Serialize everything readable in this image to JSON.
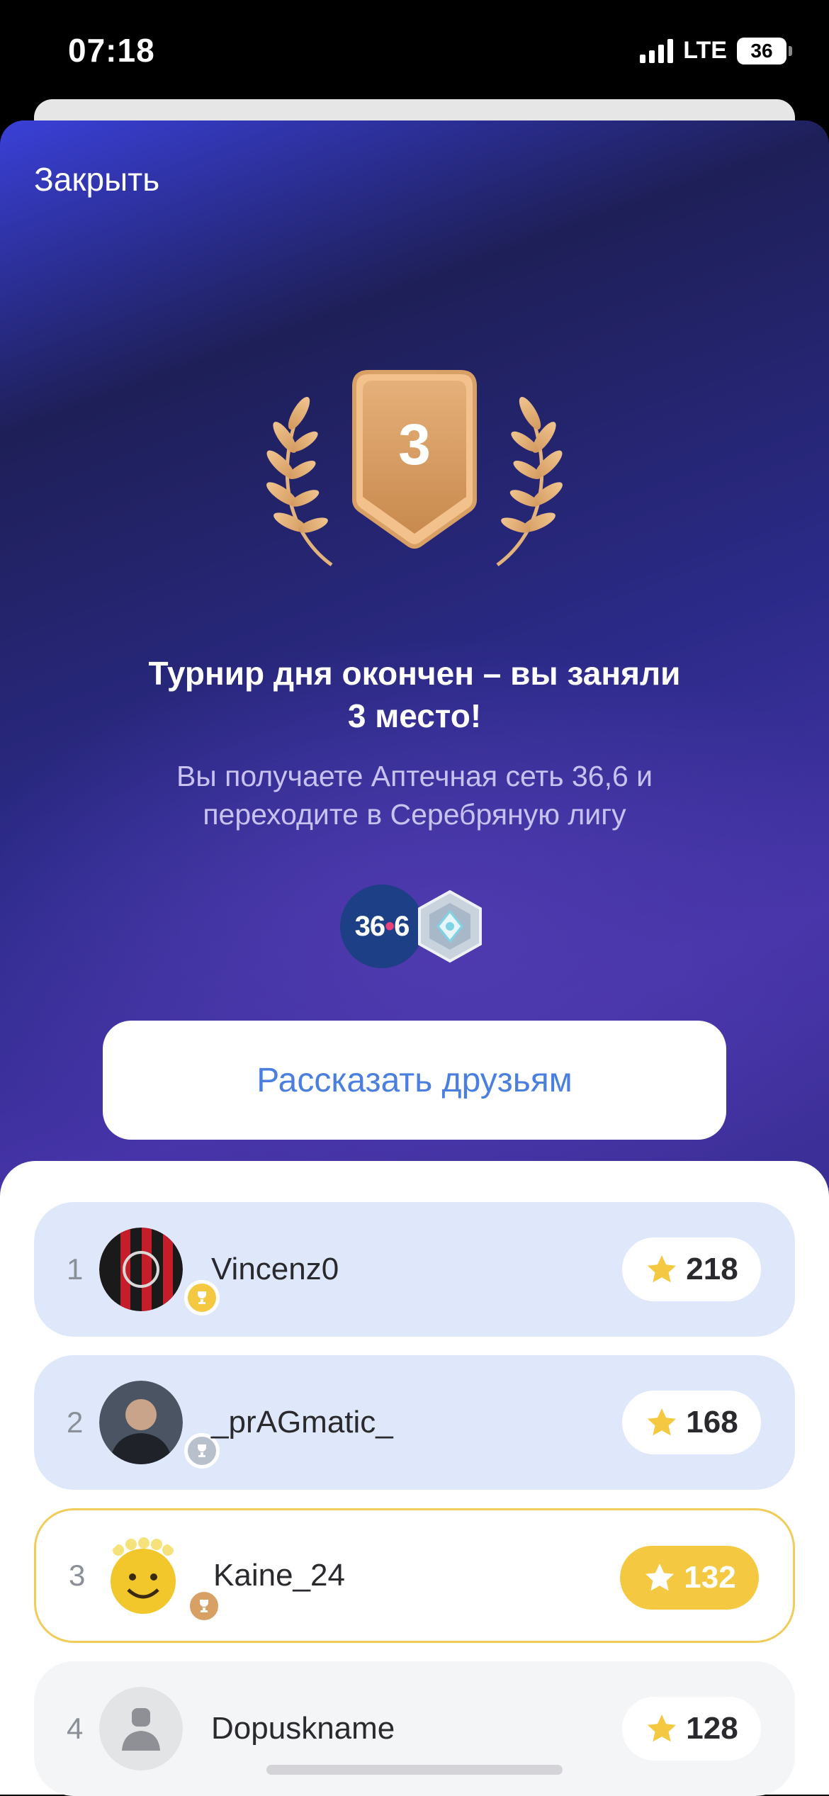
{
  "status_bar": {
    "time": "07:18",
    "network": "LTE",
    "battery": "36"
  },
  "sheet": {
    "close_label": "Закрыть",
    "place_number": "3",
    "headline_line1": "Турнир дня окончен – вы заняли",
    "headline_line2": "3 место!",
    "subline_line1": "Вы получаете Аптечная сеть 36,6 и",
    "subline_line2": "переходите в Серебряную лигу",
    "brand_badge_left": "36",
    "brand_badge_dot": "•",
    "brand_badge_right": "6",
    "league_icon": "silver-league-icon",
    "share_label": "Рассказать друзьям"
  },
  "colors": {
    "accent": "#4a7fe0",
    "gold": "#f5c842",
    "bronze": "#d9a066",
    "row_highlight": "#dfe8fb"
  },
  "leaderboard": {
    "rows": [
      {
        "rank": "1",
        "name": "Vincenz0",
        "score": "218",
        "medal": "gold-trophy-icon"
      },
      {
        "rank": "2",
        "name": "_prAGmatic_",
        "score": "168",
        "medal": "silver-trophy-icon"
      },
      {
        "rank": "3",
        "name": "Kaine_24",
        "score": "132",
        "medal": "bronze-trophy-icon"
      },
      {
        "rank": "4",
        "name": "Dopuskname",
        "score": "128",
        "medal": ""
      }
    ]
  }
}
